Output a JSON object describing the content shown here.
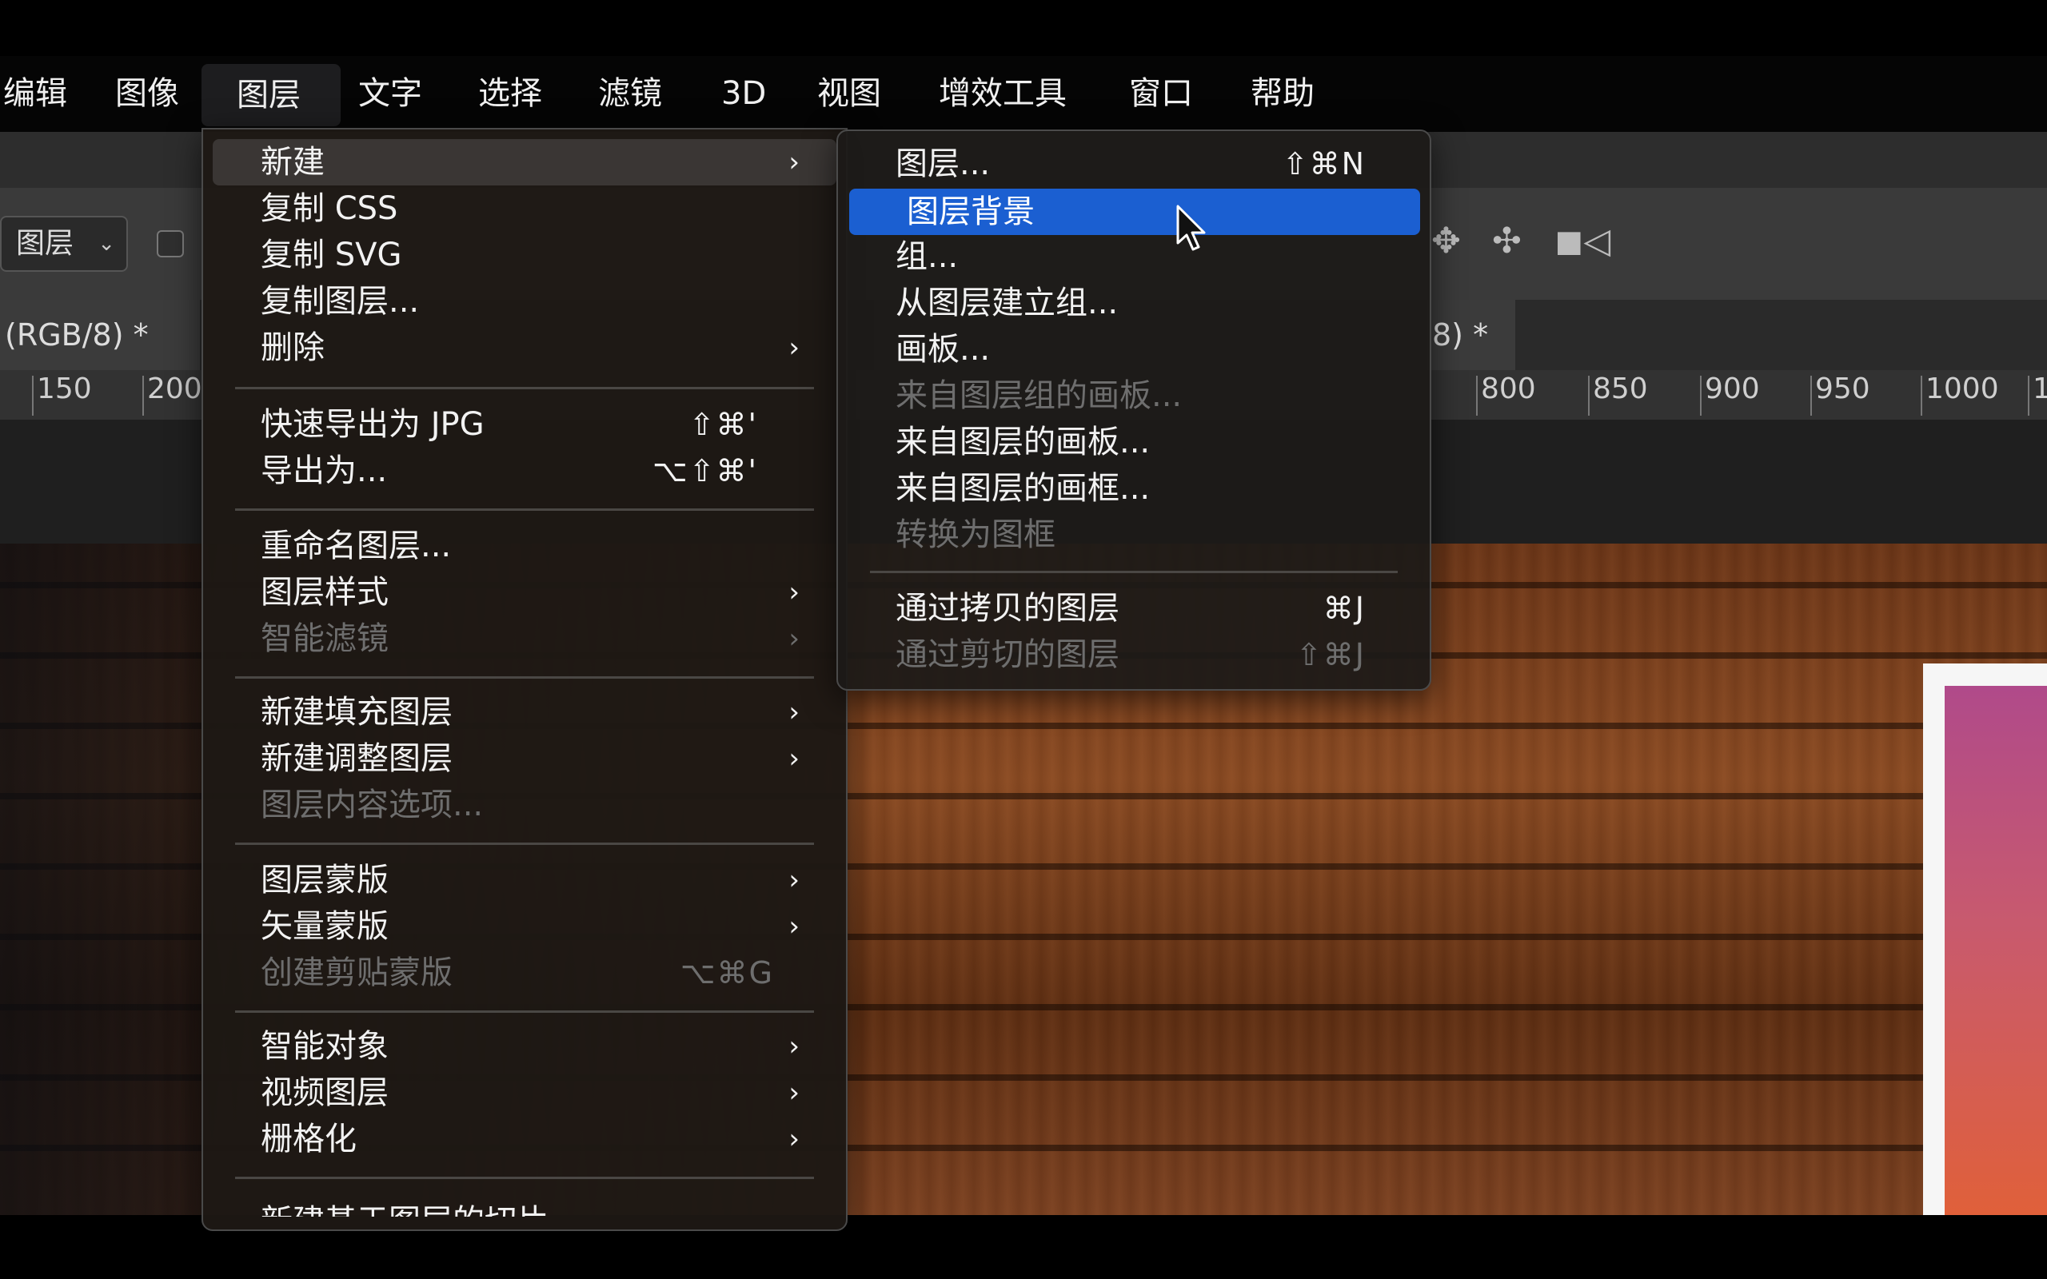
{
  "menubar": {
    "items": [
      "编辑",
      "图像",
      "图层",
      "文字",
      "选择",
      "滤镜",
      "3D",
      "视图",
      "增效工具",
      "窗口",
      "帮助"
    ]
  },
  "options": {
    "layer_select": "图层"
  },
  "tabs": {
    "left": "(RGB/8) *",
    "right": "8) *"
  },
  "ruler": {
    "left_ticks": [
      "150",
      "200"
    ],
    "right_ticks": [
      "800",
      "850",
      "900",
      "950",
      "1000",
      "1"
    ]
  },
  "layer_menu": {
    "items": [
      {
        "label": "新建",
        "arrow": "›"
      },
      {
        "label": "复制 CSS"
      },
      {
        "label": "复制 SVG"
      },
      {
        "label": "复制图层..."
      },
      {
        "label": "删除",
        "arrow": "›"
      },
      {
        "label": "快速导出为 JPG",
        "shortcut": "⇧⌘'"
      },
      {
        "label": "导出为...",
        "shortcut": "⌥⇧⌘'"
      },
      {
        "label": "重命名图层..."
      },
      {
        "label": "图层样式",
        "arrow": "›"
      },
      {
        "label": "智能滤镜",
        "arrow": "›"
      },
      {
        "label": "新建填充图层",
        "arrow": "›"
      },
      {
        "label": "新建调整图层",
        "arrow": "›"
      },
      {
        "label": "图层内容选项..."
      },
      {
        "label": "图层蒙版",
        "arrow": "›"
      },
      {
        "label": "矢量蒙版",
        "arrow": "›"
      },
      {
        "label": "创建剪贴蒙版",
        "shortcut": "⌥⌘G"
      },
      {
        "label": "智能对象",
        "arrow": "›"
      },
      {
        "label": "视频图层",
        "arrow": "›"
      },
      {
        "label": "栅格化",
        "arrow": "›"
      },
      {
        "label": "新建基于图层的切片"
      }
    ]
  },
  "new_submenu": {
    "items": [
      {
        "label": "图层...",
        "shortcut": "⇧⌘N"
      },
      {
        "label": "图层背景"
      },
      {
        "label": "组..."
      },
      {
        "label": "从图层建立组..."
      },
      {
        "label": "画板..."
      },
      {
        "label": "来自图层组的画板..."
      },
      {
        "label": "来自图层的画板..."
      },
      {
        "label": "来自图层的画框..."
      },
      {
        "label": "转换为图框"
      },
      {
        "label": "通过拷贝的图层",
        "shortcut": "⌘J"
      },
      {
        "label": "通过剪切的图层",
        "shortcut": "⇧⌘J"
      }
    ]
  },
  "colors": {
    "highlight": "#1b5fd1",
    "menubar": "#050505"
  }
}
